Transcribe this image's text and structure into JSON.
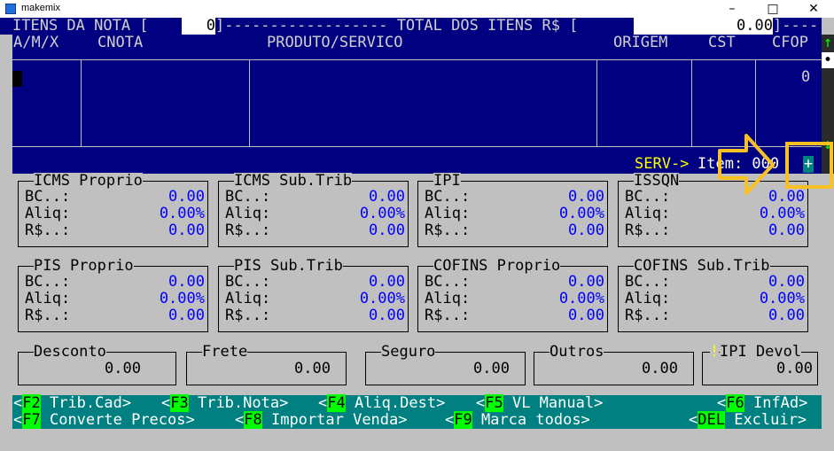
{
  "window": {
    "title": "makemix",
    "minimize": "–",
    "maximize": "□",
    "close": "✕"
  },
  "header": {
    "itens_label": "ITENS DA NOTA [",
    "itens_value": "0",
    "separator": "]------------------ TOTAL DOS ITENS R$ [",
    "total_value": "0.00",
    "tail": "]----"
  },
  "grid": {
    "columns": [
      "A/M/X",
      "CNOTA",
      "PRODUTO/SERVICO",
      "ORIGEM",
      "CST",
      "CFOP"
    ],
    "cfop_value": "0",
    "serv_label": "SERV->",
    "item_label": "Item: 000",
    "plus": "+"
  },
  "scrollbar": {
    "up": "↑",
    "thumb": "•",
    "down": "↓"
  },
  "tax_groups_row1": [
    {
      "title": "ICMS Proprio",
      "bc": "0.00",
      "aliq": "0.00%",
      "rs": "0.00"
    },
    {
      "title": "ICMS Sub.Trib",
      "bc": "0.00",
      "aliq": "0.00%",
      "rs": "0.00"
    },
    {
      "title": "IPI",
      "bc": "0.00",
      "aliq": "0.00%",
      "rs": "0.00"
    },
    {
      "title": "ISSQN",
      "bc": "0.00",
      "aliq": "0.00%",
      "rs": "0.00"
    }
  ],
  "tax_groups_row2": [
    {
      "title": "PIS Proprio",
      "bc": "0.00",
      "aliq": "0.00%",
      "rs": "0.00"
    },
    {
      "title": "PIS Sub.Trib",
      "bc": "0.00",
      "aliq": "0.00%",
      "rs": "0.00"
    },
    {
      "title": "COFINS Proprio",
      "bc": "0.00",
      "aliq": "0.00%",
      "rs": "0.00"
    },
    {
      "title": "COFINS Sub.Trib",
      "bc": "0.00",
      "aliq": "0.00%",
      "rs": "0.00"
    }
  ],
  "labels": {
    "bc": "BC..:",
    "aliq": "Aliq:",
    "rs": "R$..:"
  },
  "totals": [
    {
      "title": "Desconto",
      "value": "0.00"
    },
    {
      "title": "Frete",
      "value": "0.00"
    },
    {
      "title": "Seguro",
      "value": "0.00"
    },
    {
      "title": "Outros",
      "value": "0.00"
    },
    {
      "title": "IPI Devol",
      "value": "0.00",
      "mark": "!"
    }
  ],
  "fkeys_row1": [
    {
      "key": "F2",
      "label": " Trib.Cad>"
    },
    {
      "key": "F3",
      "label": " Trib.Nota>"
    },
    {
      "key": "F4",
      "label": " Aliq.Dest>"
    },
    {
      "key": "F5",
      "label": " VL Manual>"
    },
    {
      "key": "F6",
      "label": " InfAd>"
    }
  ],
  "fkeys_row2": [
    {
      "key": "F7",
      "label": " Converte Precos>"
    },
    {
      "key": "F8",
      "label": " Importar Venda>"
    },
    {
      "key": "F9",
      "label": " Marca todos>"
    },
    {
      "key": "DEL",
      "label": " Excluir>"
    }
  ],
  "colors": {
    "background": "#c0c0c0",
    "grid": "#000080",
    "value": "#0000ff",
    "fbar": "#008080",
    "fkey": "#00ff00",
    "highlight": "#f8c020"
  }
}
